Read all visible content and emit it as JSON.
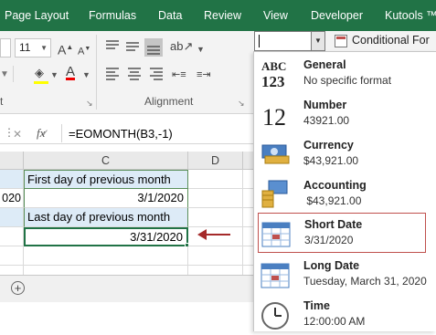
{
  "ribbon": {
    "tabs": [
      "Page Layout",
      "Formulas",
      "Data",
      "Review",
      "View",
      "Developer",
      "Kutools ™"
    ],
    "font_size": "11",
    "group_alignment": "Alignment",
    "group_font_partial": "t",
    "number_format_value": "",
    "conditional_formatting": "Conditional For",
    "accent_color": "#217346"
  },
  "formula_bar": {
    "fx_label": "fx",
    "formula": "=EOMONTH(B3,-1)"
  },
  "sheet": {
    "columns": [
      "C",
      "D"
    ],
    "rows": [
      {
        "b": "",
        "c": "First day of previous month",
        "c_style": "label"
      },
      {
        "b": "020",
        "c": "3/1/2020",
        "c_style": "value"
      },
      {
        "b": "",
        "c": "Last day of previous month",
        "c_style": "label"
      },
      {
        "b": "",
        "c": "3/31/2020",
        "c_style": "selected"
      }
    ],
    "add_sheet_icon": "plus-circle-icon",
    "arrow_color": "#c0504d"
  },
  "number_formats": [
    {
      "name": "General",
      "example": "No specific format",
      "icon": "abc-123-icon"
    },
    {
      "name": "Number",
      "example": "43921.00",
      "icon": "number-12-icon"
    },
    {
      "name": "Currency",
      "example": "$43,921.00",
      "icon": "currency-icon"
    },
    {
      "name": "Accounting",
      "example": " $43,921.00",
      "icon": "accounting-icon"
    },
    {
      "name": "Short Date",
      "example": "3/31/2020",
      "icon": "calendar-icon",
      "selected": true
    },
    {
      "name": "Long Date",
      "example": "Tuesday, March 31, 2020",
      "icon": "calendar-icon"
    },
    {
      "name": "Time",
      "example": "12:00:00 AM",
      "icon": "clock-icon"
    }
  ],
  "icon_glyphs": {
    "abc": "ABC",
    "num123": "123",
    "num12": "12"
  }
}
